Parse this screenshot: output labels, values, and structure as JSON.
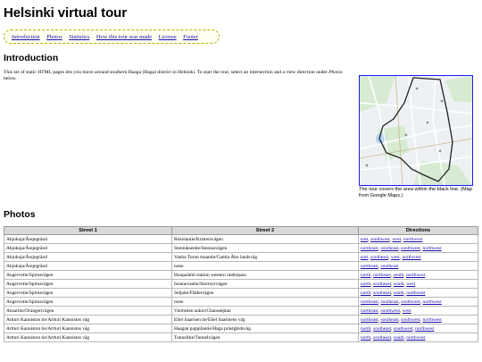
{
  "title": "Helsinki virtual tour",
  "toc": [
    "Introduction",
    "Photos",
    "Statistics",
    "How this tour was made",
    "License",
    "Footer"
  ],
  "intro": {
    "heading": "Introduction",
    "text_before": "This set of static HTML pages lets you move around southern Haaga (Haga) district in Helsinki. To start the tour, select an intersection and a view direction under ",
    "text_link": "Photos",
    "text_after": " below."
  },
  "map": {
    "caption": "The tour covers the area within the black line. (Map from Google Maps.)",
    "colors": {
      "background": "#eef1f3",
      "park": "#d6ebd2",
      "road": "#ffffff",
      "boundary": "#222222",
      "water": "#b3d3f2"
    }
  },
  "photos": {
    "heading": "Photos",
    "columns": [
      "Street 1",
      "Street 2",
      "Directions"
    ],
    "rows": [
      {
        "s1": "Ahjokuja/Åssjegränd",
        "s2": "Ristolantie/Kristersvägen",
        "dirs": [
          "east",
          "southwest",
          "west",
          "northwest"
        ]
      },
      {
        "s1": "Ahjokuja/Åssjegränd",
        "s2": "Steniuksentie/Steniusvägen",
        "dirs": [
          "northeast",
          "southeast",
          "southwest",
          "northwest"
        ]
      },
      {
        "s1": "Ahjokuja/Åssjegränd",
        "s2": "Vanha Turun maantie/Gamla Åbo landsväg",
        "dirs": [
          "east",
          "southeast",
          "west",
          "northwest"
        ]
      },
      {
        "s1": "Ahjokuja/Åssjegränd",
        "s2": "none",
        "dirs": [
          "northeast",
          "southeast"
        ]
      },
      {
        "s1": "Angervotie/Spireavägen",
        "s2": "Huopalahti station western underpass",
        "dirs": [
          "north",
          "northeast",
          "south",
          "northwest"
        ]
      },
      {
        "s1": "Angervotie/Spireavägen",
        "s2": "Isonnevantie/Stormyrvägen",
        "dirs": [
          "north",
          "southeast",
          "south",
          "west"
        ]
      },
      {
        "s1": "Angervotie/Spireavägen",
        "s2": "Seljatie/Flädervägen",
        "dirs": [
          "north",
          "southeast",
          "south",
          "northwest"
        ]
      },
      {
        "s1": "Angervotie/Spireavägen",
        "s2": "none",
        "dirs": [
          "northeast",
          "southeast",
          "southwest",
          "northwest"
        ]
      },
      {
        "s1": "Ansaritie/Orangerivägen",
        "s2": "Viertotien aukio/Chausséplan",
        "dirs": [
          "northeast",
          "southwest",
          "west"
        ]
      },
      {
        "s1": "Artturi Kanniston tie/Artturi Kannistos väg",
        "s2": "Eliel Saarisen tie/Eliel Saarinens väg",
        "dirs": [
          "northeast",
          "southeast",
          "southwest",
          "northwest"
        ]
      },
      {
        "s1": "Artturi Kanniston tie/Artturi Kannistos väg",
        "s2": "Haagan pappilantie/Haga prästgårdsväg",
        "dirs": [
          "north",
          "southeast",
          "southwest",
          "northwest"
        ]
      },
      {
        "s1": "Artturi Kanniston tie/Artturi Kannistos väg",
        "s2": "Tunnelitie/Tunnelvägen",
        "dirs": [
          "north",
          "southeast",
          "south",
          "northwest"
        ]
      }
    ]
  }
}
